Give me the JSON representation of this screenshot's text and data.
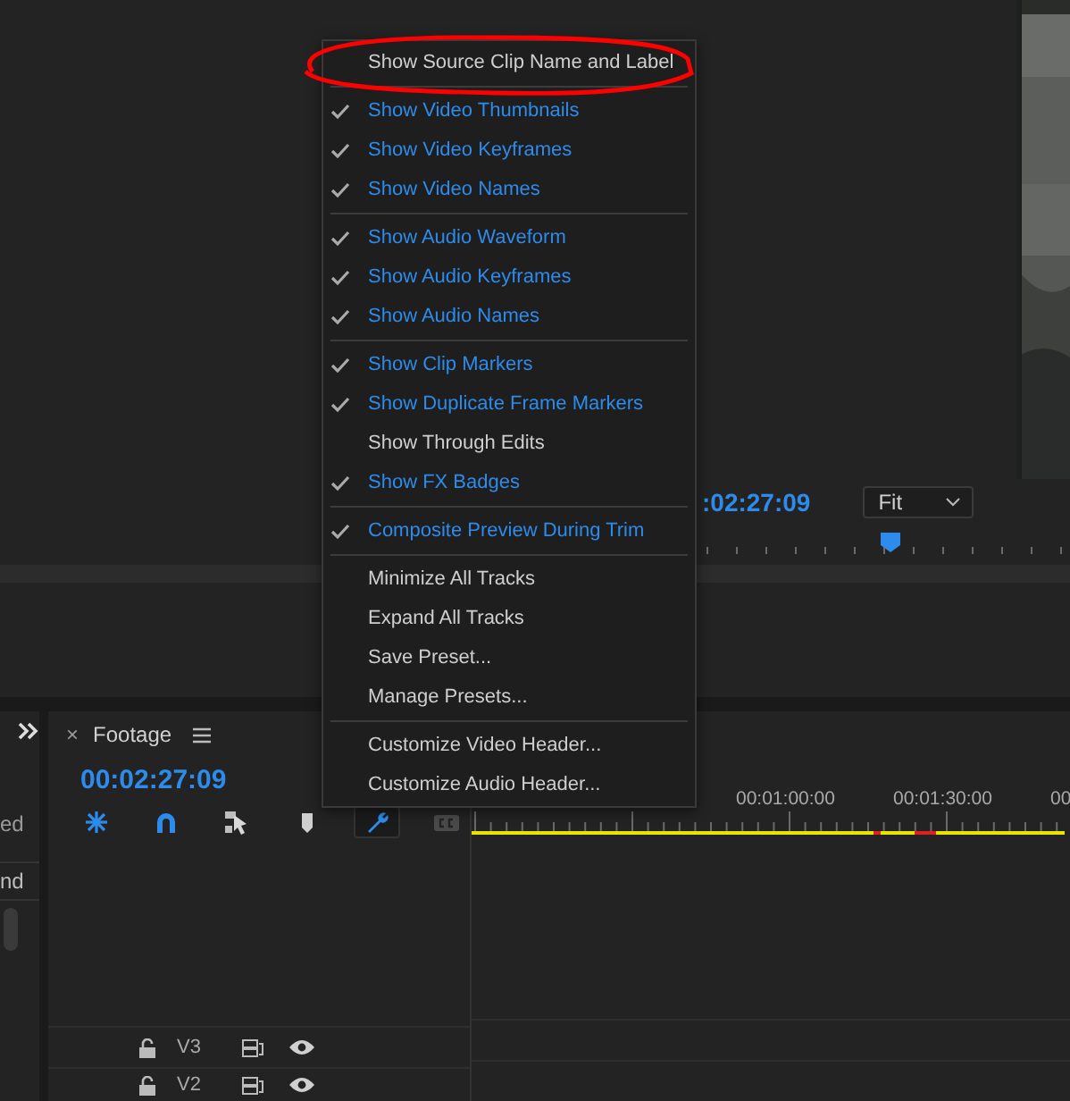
{
  "program_monitor": {
    "timecode": ":02:27:09",
    "zoom_dropdown": {
      "value": "Fit"
    }
  },
  "left_panel": {
    "texts": [
      "ed",
      "nd"
    ]
  },
  "timeline": {
    "tab": {
      "close": "×",
      "title": "Footage"
    },
    "timecode": "00:02:27:09",
    "toolbar": [
      {
        "kind": "nest",
        "selected": false
      },
      {
        "kind": "snap",
        "selected": false
      },
      {
        "kind": "linked",
        "selected": false
      },
      {
        "kind": "marker",
        "selected": false
      },
      {
        "kind": "settings",
        "selected": true
      },
      {
        "kind": "captions",
        "selected": false
      }
    ],
    "ruler_labels": [
      "00:01:00:00",
      "00:01:30:00",
      "00"
    ],
    "tracks": [
      {
        "name": "V3"
      },
      {
        "name": "V2"
      }
    ]
  },
  "menu": {
    "groups": [
      {
        "items": [
          {
            "label": "Show Source Clip Name and Label",
            "checked": false,
            "circled": true
          }
        ]
      },
      {
        "items": [
          {
            "label": "Show Video Thumbnails",
            "checked": true,
            "circled": false
          },
          {
            "label": "Show Video Keyframes",
            "checked": true,
            "circled": false
          },
          {
            "label": "Show Video Names",
            "checked": true,
            "circled": false
          }
        ]
      },
      {
        "items": [
          {
            "label": "Show Audio Waveform",
            "checked": true,
            "circled": false
          },
          {
            "label": "Show Audio Keyframes",
            "checked": true,
            "circled": false
          },
          {
            "label": "Show Audio Names",
            "checked": true,
            "circled": false
          }
        ]
      },
      {
        "items": [
          {
            "label": "Show Clip Markers",
            "checked": true,
            "circled": false
          },
          {
            "label": "Show Duplicate Frame Markers",
            "checked": true,
            "circled": false
          },
          {
            "label": "Show Through Edits",
            "checked": false,
            "circled": false
          },
          {
            "label": "Show FX Badges",
            "checked": true,
            "circled": false
          }
        ]
      },
      {
        "items": [
          {
            "label": "Composite Preview During Trim",
            "checked": true,
            "circled": false
          }
        ]
      },
      {
        "items": [
          {
            "label": "Minimize All Tracks",
            "checked": false,
            "circled": false
          },
          {
            "label": "Expand All Tracks",
            "checked": false,
            "circled": false
          },
          {
            "label": "Save Preset...",
            "checked": false,
            "circled": false
          },
          {
            "label": "Manage Presets...",
            "checked": false,
            "circled": false
          }
        ]
      },
      {
        "items": [
          {
            "label": "Customize Video Header...",
            "checked": false,
            "circled": false
          },
          {
            "label": "Customize Audio Header...",
            "checked": false,
            "circled": false
          }
        ]
      }
    ]
  }
}
